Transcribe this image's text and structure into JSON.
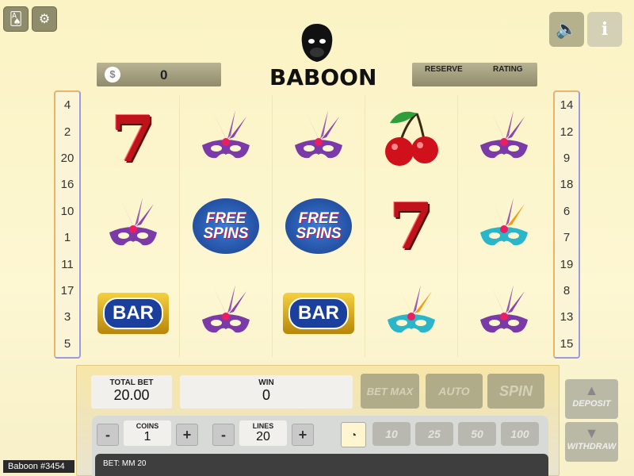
{
  "top_left_icons": [
    "cards-icon",
    "settings-icon"
  ],
  "top_right_icons": [
    "sound-icon",
    "info-icon"
  ],
  "info_icon_glyph": "i",
  "balance": {
    "value": "0"
  },
  "logo": {
    "name": "BABOON"
  },
  "header_right": {
    "reserve_label": "RESERVE",
    "rating_label": "RATING"
  },
  "paylines_left": [
    "4",
    "2",
    "20",
    "16",
    "10",
    "1",
    "11",
    "17",
    "3",
    "5"
  ],
  "paylines_right": [
    "14",
    "12",
    "9",
    "18",
    "6",
    "7",
    "19",
    "8",
    "13",
    "15"
  ],
  "reels": [
    [
      "seven",
      "mask",
      "bar"
    ],
    [
      "mask",
      "free_spins",
      "mask"
    ],
    [
      "mask",
      "free_spins",
      "bar"
    ],
    [
      "cherry",
      "seven",
      "mask_gold"
    ],
    [
      "mask",
      "mask_gold",
      "mask"
    ]
  ],
  "symbols": {
    "seven": "7",
    "bar": "BAR",
    "free_top": "FREE",
    "free_bottom": "SPINS"
  },
  "panel": {
    "total_bet_label": "TOTAL BET",
    "total_bet": "20.00",
    "win_label": "WIN",
    "win": "0",
    "bet_max": "BET MAX",
    "auto": "AUTO",
    "spin": "SPIN"
  },
  "controls": {
    "minus": "-",
    "plus": "+",
    "coins_label": "COINS",
    "coins": "1",
    "lines_label": "LINES",
    "lines": "20",
    "speeds": [
      "10",
      "25",
      "50",
      "100"
    ]
  },
  "bet_status": "BET: MM 20",
  "side": {
    "deposit": "DEPOSIT",
    "withdraw": "WITHDRAW"
  },
  "game_tag": "Baboon #3454",
  "colors": {
    "accent": "#b5b18c",
    "reel_bg": "#fdf7d2"
  }
}
